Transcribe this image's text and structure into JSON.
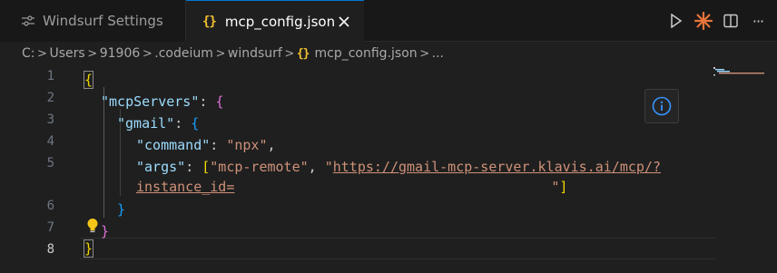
{
  "tabs": [
    {
      "label": "Windsurf Settings",
      "icon": "settings-sliders-icon",
      "active": false
    },
    {
      "label": "mcp_config.json",
      "icon": "json-braces-icon",
      "active": true
    }
  ],
  "tab_icon_glyph": "{}",
  "actions": [
    "run-icon",
    "windsurf-spark-icon",
    "split-editor-icon",
    "more-icon"
  ],
  "more_label": "···",
  "breadcrumb": {
    "items": [
      "C:",
      "Users",
      "91906",
      ".codeium",
      "windsurf",
      "mcp_config.json",
      "..."
    ],
    "separator": ">"
  },
  "editor": {
    "line_numbers": [
      "1",
      "2",
      "3",
      "4",
      "5",
      "6",
      "7",
      "8"
    ],
    "active_line": "8",
    "code": {
      "open_brace": "{",
      "close_brace": "}",
      "key_mcpServers": "\"mcpServers\"",
      "key_gmail": "\"gmail\"",
      "key_command": "\"command\"",
      "val_command": "\"npx\"",
      "key_args": "\"args\"",
      "arg1": "\"mcp-remote\"",
      "arg2_quote": "\"",
      "arg2_url": "https://gmail-mcp-server.klavis.ai/mcp/?",
      "arg2_cont": "instance_id=",
      "arg2_end_quote": "\"",
      "colon": ": ",
      "comma": ",",
      "comma_space": ", ",
      "open_bracket": "[",
      "close_bracket": "]"
    }
  },
  "colors": {
    "background": "#1f1f1f",
    "tabbar": "#181818",
    "key": "#9cdcfe",
    "string": "#ce9178",
    "brace_level1": "#f1d700",
    "brace_level2": "#da70d6",
    "brace_level3": "#179fff",
    "json_icon": "#f1c232",
    "accent": "#0078d4"
  }
}
